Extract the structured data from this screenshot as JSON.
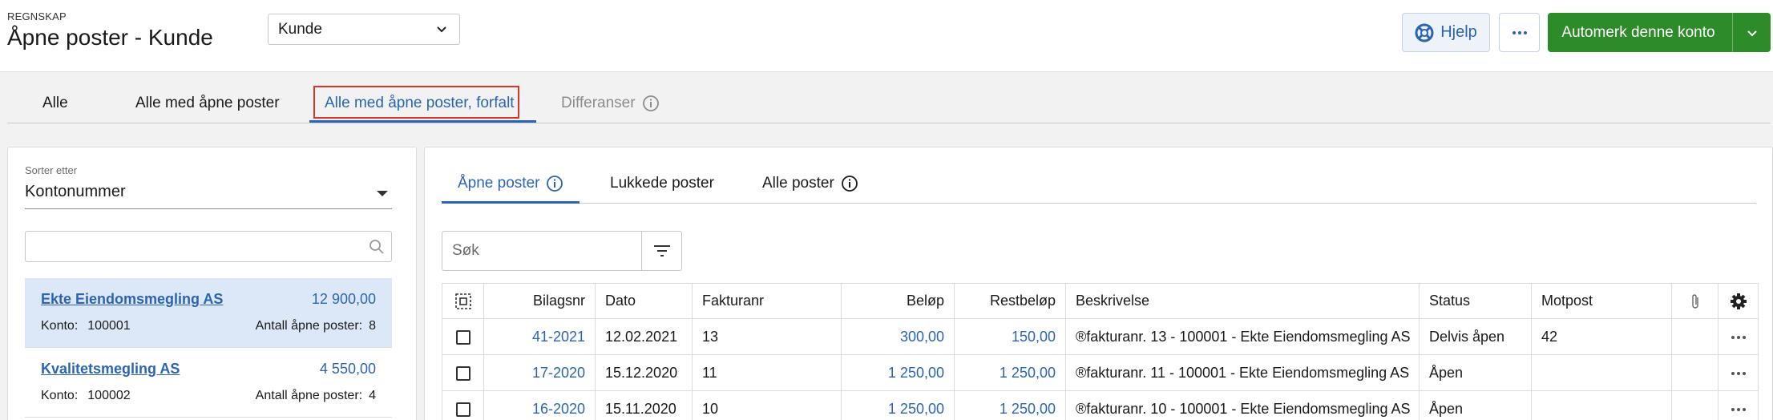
{
  "header": {
    "eyebrow": "REGNSKAP",
    "title": "Åpne poster - Kunde",
    "type_select": "Kunde",
    "help_label": "Hjelp",
    "primary_action": "Automerk denne konto"
  },
  "tabs": {
    "all": "Alle",
    "all_open": "Alle med åpne poster",
    "all_open_overdue": "Alle med åpne poster, forfalt",
    "differences": "Differanser",
    "active": "all_open_overdue"
  },
  "left": {
    "sort_label": "Sorter etter",
    "sort_value": "Kontonummer",
    "search_value": "",
    "konto_label": "Konto:",
    "open_label": "Antall åpne poster:",
    "customers": [
      {
        "name": "Ekte Eiendomsmegling AS",
        "amount": "12 900,00",
        "konto": "100001",
        "open": "8",
        "selected": true
      },
      {
        "name": "Kvalitetsmegling AS",
        "amount": "4 550,00",
        "konto": "100002",
        "open": "4",
        "selected": false
      }
    ]
  },
  "right": {
    "subtabs": {
      "open": "Åpne poster",
      "closed": "Lukkede poster",
      "all": "Alle poster"
    },
    "search_placeholder": "Søk",
    "columns": {
      "bilagsnr": "Bilagsnr",
      "dato": "Dato",
      "fakturanr": "Fakturanr",
      "belop": "Beløp",
      "restbelop": "Restbeløp",
      "beskrivelse": "Beskrivelse",
      "status": "Status",
      "motpost": "Motpost"
    },
    "rows": [
      {
        "bilagsnr": "41-2021",
        "dato": "12.02.2021",
        "fakturanr": "13",
        "belop": "300,00",
        "restbelop": "150,00",
        "beskrivelse": "®fakturanr. 13 - 100001 - Ekte Eiendomsmegling AS",
        "status": "Delvis åpen",
        "motpost": "42"
      },
      {
        "bilagsnr": "17-2020",
        "dato": "15.12.2020",
        "fakturanr": "11",
        "belop": "1 250,00",
        "restbelop": "1 250,00",
        "beskrivelse": "®fakturanr. 11 - 100001 - Ekte Eiendomsmegling AS",
        "status": "Åpen",
        "motpost": ""
      },
      {
        "bilagsnr": "16-2020",
        "dato": "15.11.2020",
        "fakturanr": "10",
        "belop": "1 250,00",
        "restbelop": "1 250,00",
        "beskrivelse": "®fakturanr. 10 - 100001 - Ekte Eiendomsmegling AS",
        "status": "Åpen",
        "motpost": ""
      }
    ]
  },
  "colors": {
    "primary_blue": "#2c64b5",
    "action_green": "#2e8b2a",
    "selected_row": "#dce8f7",
    "highlight_red": "#d9362b"
  },
  "icons": {
    "help": "lifebuoy-icon",
    "more": "ellipsis-icon",
    "split": "chevron-down-icon",
    "info": "info-icon",
    "search": "search-icon",
    "filter": "filter-icon",
    "select_all": "select-all-icon",
    "attachment": "paperclip-icon",
    "settings": "gear-icon"
  }
}
